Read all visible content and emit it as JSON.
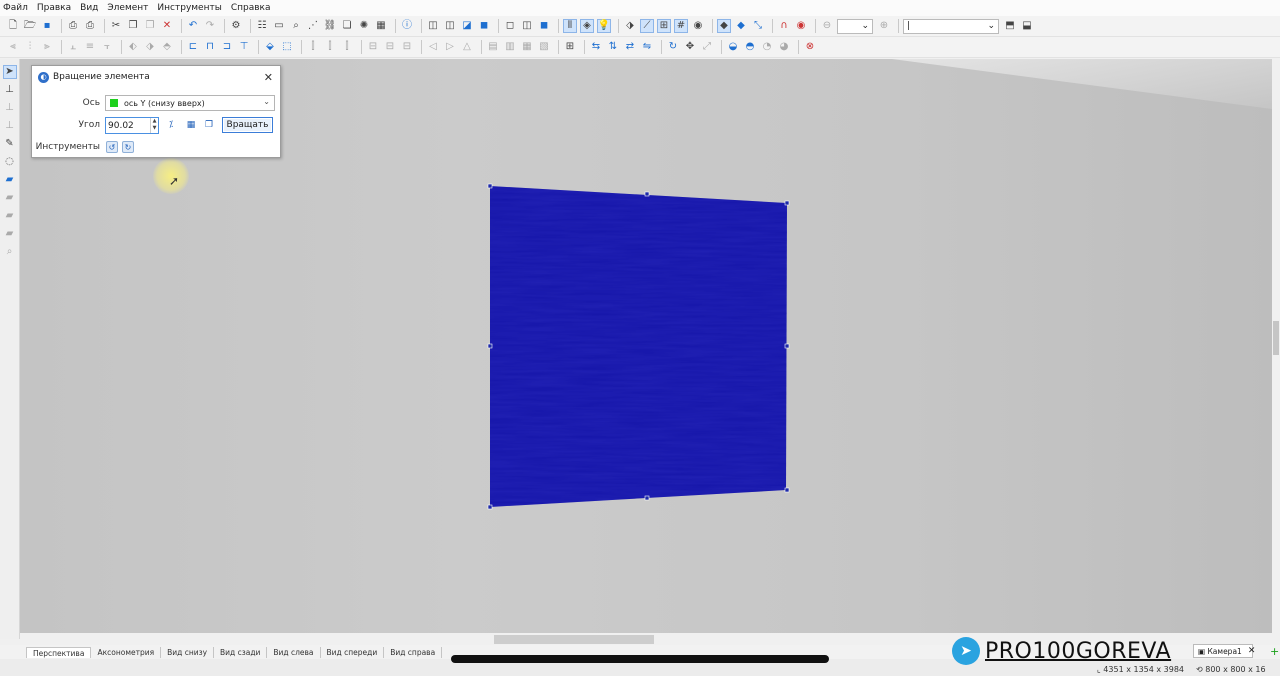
{
  "menu": {
    "items": [
      "Файл",
      "Правка",
      "Вид",
      "Элемент",
      "Инструменты",
      "Справка"
    ]
  },
  "toolbar": {
    "zoom_value": "",
    "layer_value": "|"
  },
  "dialog": {
    "title": "Вращение элемента",
    "axis_label": "Ось",
    "axis_value": "ось Y (снизу вверх)",
    "angle_label": "Угол",
    "angle_value": "90.02",
    "rotate_button": "Вращать",
    "tools_label": "Инструменты"
  },
  "views": {
    "tabs": [
      "Перспектива",
      "Аксонометрия",
      "Вид снизу",
      "Вид сзади",
      "Вид слева",
      "Вид спереди",
      "Вид справа"
    ]
  },
  "camera": {
    "tab_label": "Камера1"
  },
  "status": {
    "scene_dims": "4351 x 1354 x 3984",
    "element_dims": "800 x 800 x 16"
  },
  "watermark": {
    "text": "PRO100GOREVA"
  },
  "colors": {
    "panel": "#2121b4",
    "accent": "#3b7dd8",
    "axis_y": "#1ed01e",
    "telegram": "#2aa3e0"
  }
}
